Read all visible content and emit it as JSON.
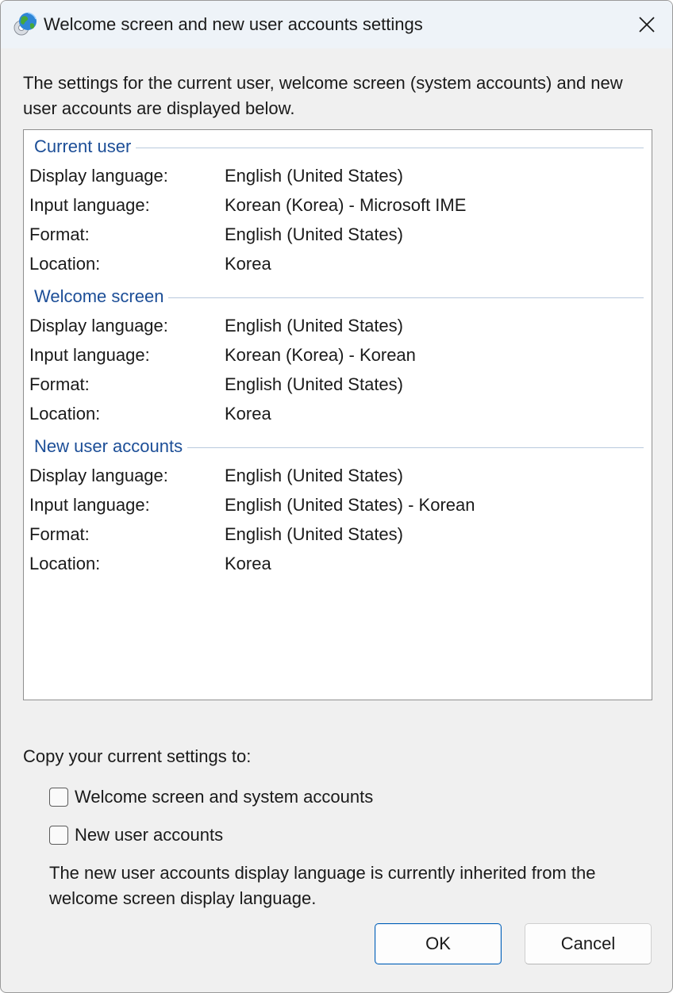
{
  "window": {
    "title": "Welcome screen and new user accounts settings",
    "icon": "globe-icon"
  },
  "intro": "The settings for the current user, welcome screen (system accounts) and new user accounts are displayed below.",
  "groups": [
    {
      "title": "Current user",
      "rows": [
        {
          "label": "Display language:",
          "value": "English (United States)"
        },
        {
          "label": "Input language:",
          "value": "Korean (Korea) - Microsoft IME"
        },
        {
          "label": "Format:",
          "value": "English (United States)"
        },
        {
          "label": "Location:",
          "value": "Korea"
        }
      ]
    },
    {
      "title": "Welcome screen",
      "rows": [
        {
          "label": "Display language:",
          "value": "English (United States)"
        },
        {
          "label": "Input language:",
          "value": "Korean (Korea) - Korean"
        },
        {
          "label": "Format:",
          "value": "English (United States)"
        },
        {
          "label": "Location:",
          "value": "Korea"
        }
      ]
    },
    {
      "title": "New user accounts",
      "rows": [
        {
          "label": "Display language:",
          "value": "English (United States)"
        },
        {
          "label": "Input language:",
          "value": "English (United States) - Korean"
        },
        {
          "label": "Format:",
          "value": "English (United States)"
        },
        {
          "label": "Location:",
          "value": "Korea"
        }
      ]
    }
  ],
  "copy": {
    "label": "Copy your current settings to:",
    "options": [
      {
        "label": "Welcome screen and system accounts",
        "checked": false
      },
      {
        "label": "New user accounts",
        "checked": false
      }
    ],
    "note": "The new user accounts display language is currently inherited from the welcome screen display language."
  },
  "buttons": {
    "ok": "OK",
    "cancel": "Cancel"
  },
  "colors": {
    "group_title": "#1c4e97",
    "ok_border": "#005fb8"
  }
}
